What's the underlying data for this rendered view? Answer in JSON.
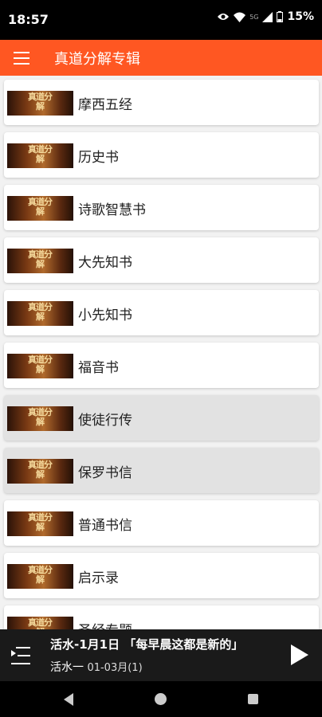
{
  "status_bar": {
    "time": "18:57",
    "battery": "15%",
    "network_label": "5G"
  },
  "app_bar": {
    "title": "真道分解专辑"
  },
  "albums": [
    {
      "label": "摩西五经",
      "thumb_text": "真道分解"
    },
    {
      "label": "历史书",
      "thumb_text": "真道分解"
    },
    {
      "label": "诗歌智慧书",
      "thumb_text": "真道分解"
    },
    {
      "label": "大先知书",
      "thumb_text": "真道分解"
    },
    {
      "label": "小先知书",
      "thumb_text": "真道分解"
    },
    {
      "label": "福音书",
      "thumb_text": "真道分解"
    },
    {
      "label": "使徒行传",
      "thumb_text": "真道分解"
    },
    {
      "label": "保罗书信",
      "thumb_text": "真道分解"
    },
    {
      "label": "普通书信",
      "thumb_text": "真道分解"
    },
    {
      "label": "启示录",
      "thumb_text": "真道分解"
    },
    {
      "label": "圣经专题",
      "thumb_text": "真道分解"
    }
  ],
  "player": {
    "title": "活水-1月1日 「每早晨这都是新的」",
    "album": "活水一",
    "date_range": "01-03月(1)"
  },
  "colors": {
    "accent": "#ff5722",
    "player_bg": "#1a1a1a"
  }
}
